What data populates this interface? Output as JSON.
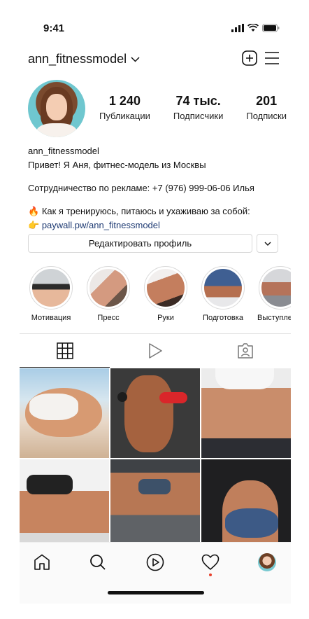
{
  "status_bar": {
    "time": "9:41"
  },
  "header": {
    "username": "ann_fitnessmodel"
  },
  "profile": {
    "stats": [
      {
        "value": "1 240",
        "label": "Публикации"
      },
      {
        "value": "74 тыс.",
        "label": "Подписчики"
      },
      {
        "value": "201",
        "label": "Подписки"
      }
    ],
    "bio": {
      "name": "ann_fitnessmodel",
      "line1": "Привет! Я Аня, фитнес-модель из Москвы",
      "line2": "Сотрудничество по рекламе: +7 (976) 999-06-06 Илья",
      "line3_emoji": "🔥",
      "line3": "Как я тренируюсь, питаюсь и ухаживаю за собой:",
      "link_emoji": "👉",
      "link": "paywall.pw/ann_fitnessmodel"
    },
    "edit_button_label": "Редактировать профиль"
  },
  "highlights": [
    {
      "label": "Мотивация"
    },
    {
      "label": "Пресс"
    },
    {
      "label": "Руки"
    },
    {
      "label": "Подготовка"
    },
    {
      "label": "Выступления"
    }
  ],
  "tabs": [
    "grid-icon",
    "reels-play-icon",
    "tagged-person-icon"
  ],
  "nav": [
    "home-icon",
    "search-icon",
    "reels-icon",
    "heart-icon",
    "profile-avatar"
  ]
}
